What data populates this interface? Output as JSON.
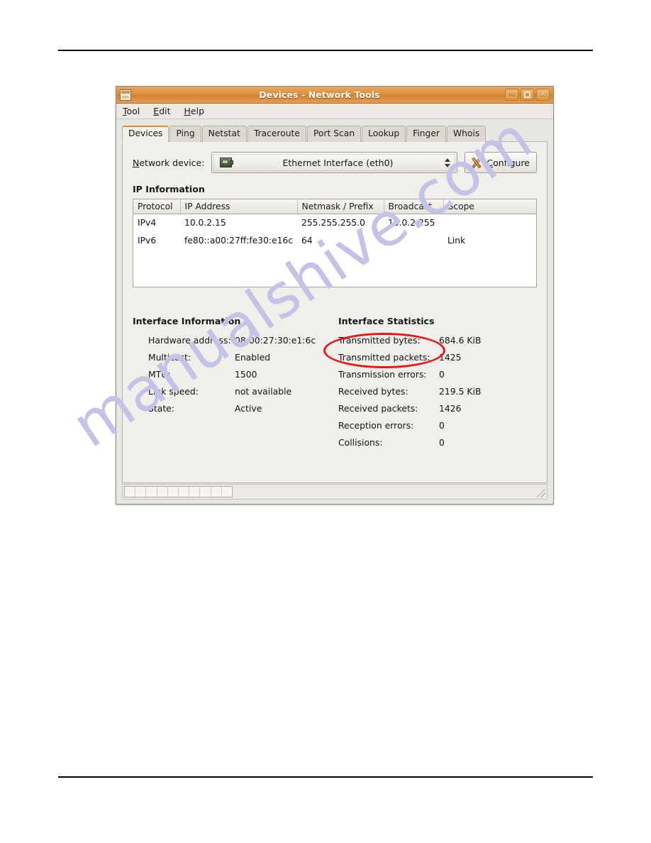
{
  "window": {
    "title": "Devices - Network Tools",
    "icon": "app-window-icon",
    "controls": {
      "minimize": "minimize-button",
      "maximize": "maximize-button",
      "close_label": "✕"
    }
  },
  "menubar": {
    "items": [
      {
        "label": "Tool",
        "accel": "T"
      },
      {
        "label": "Edit",
        "accel": "E"
      },
      {
        "label": "Help",
        "accel": "H"
      }
    ]
  },
  "tabs": [
    {
      "label": "Devices",
      "active": true
    },
    {
      "label": "Ping",
      "active": false
    },
    {
      "label": "Netstat",
      "active": false
    },
    {
      "label": "Traceroute",
      "active": false
    },
    {
      "label": "Port Scan",
      "active": false
    },
    {
      "label": "Lookup",
      "active": false
    },
    {
      "label": "Finger",
      "active": false
    },
    {
      "label": "Whois",
      "active": false
    }
  ],
  "device_row": {
    "label": "Network device:",
    "label_accel": "N",
    "selected_device": "Ethernet Interface (eth0)",
    "configure_label": "Configure",
    "configure_accel": "C"
  },
  "ip_information": {
    "title": "IP Information",
    "columns": [
      "Protocol",
      "IP Address",
      "Netmask / Prefix",
      "Broadcast",
      "Scope"
    ],
    "rows": [
      {
        "protocol": "IPv4",
        "address": "10.0.2.15",
        "netmask": "255.255.255.0",
        "broadcast": "10.0.2.255",
        "scope": ""
      },
      {
        "protocol": "IPv6",
        "address": "fe80::a00:27ff:fe30:e16c",
        "netmask": "64",
        "broadcast": "",
        "scope": "Link"
      }
    ]
  },
  "interface_information": {
    "title": "Interface Information",
    "rows": [
      {
        "key": "Hardware address:",
        "value": "08:00:27:30:e1:6c"
      },
      {
        "key": "Multicast:",
        "value": "Enabled"
      },
      {
        "key": "MTU:",
        "value": "1500"
      },
      {
        "key": "Link speed:",
        "value": "not available"
      },
      {
        "key": "State:",
        "value": "Active"
      }
    ]
  },
  "interface_statistics": {
    "title": "Interface Statistics",
    "rows": [
      {
        "key": "Transmitted bytes:",
        "value": "684.6 KiB"
      },
      {
        "key": "Transmitted packets:",
        "value": "1425"
      },
      {
        "key": "Transmission errors:",
        "value": "0"
      },
      {
        "key": "Received bytes:",
        "value": "219.5 KiB"
      },
      {
        "key": "Received packets:",
        "value": "1426"
      },
      {
        "key": "Reception errors:",
        "value": "0"
      },
      {
        "key": "Collisions:",
        "value": "0"
      }
    ]
  },
  "annotation": {
    "shape": "ellipse",
    "color": "#e8161a",
    "target": "Interface Statistics"
  },
  "watermark": {
    "text": "manualshive.com",
    "color": "#c3c3e8"
  }
}
